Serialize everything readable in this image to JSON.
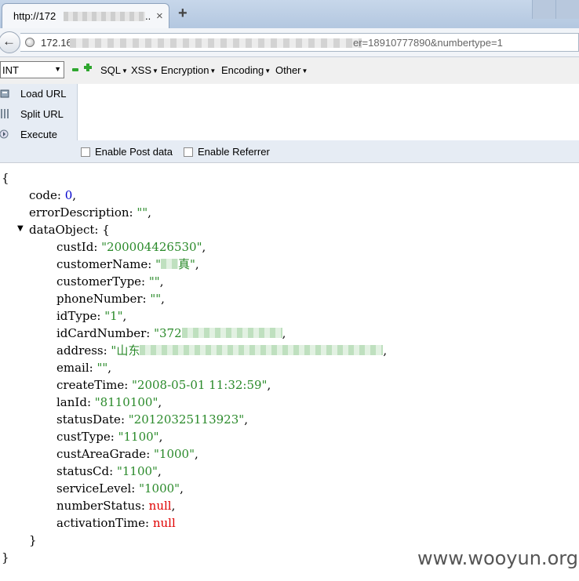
{
  "browser": {
    "tab_title": "http://172",
    "tab_ellipsis": "..",
    "close_glyph": "×",
    "newtab_glyph": "+",
    "url_prefix": "172.16",
    "url_suffix": "er=18910777890&numbertype=1"
  },
  "hackbar": {
    "type_select": "INT",
    "menus": [
      "SQL",
      "XSS",
      "Encryption",
      "Encoding",
      "Other"
    ],
    "load_url": "Load URL",
    "split_url": "Split URL",
    "execute": "Execute",
    "enable_post": "Enable Post data",
    "enable_referrer": "Enable Referrer"
  },
  "json": {
    "open_brace": "{",
    "close_brace": "}",
    "inner_open": "{",
    "inner_close": "}",
    "code": {
      "key": "code",
      "value": "0"
    },
    "errorDescription": {
      "key": "errorDescription",
      "value": "\"\""
    },
    "dataObject": {
      "key": "dataObject"
    },
    "fields": [
      {
        "key": "custId",
        "value": "\"200004426530\"",
        "type": "s"
      },
      {
        "key": "customerName",
        "value": "真\"",
        "prefix": "\"",
        "masked": true,
        "type": "s"
      },
      {
        "key": "customerType",
        "value": "\"\"",
        "type": "s"
      },
      {
        "key": "phoneNumber",
        "value": "\"\"",
        "type": "s"
      },
      {
        "key": "idType",
        "value": "\"1\"",
        "type": "s"
      },
      {
        "key": "idCardNumber",
        "value": "\"372",
        "masked": true,
        "type": "s"
      },
      {
        "key": "address",
        "value": "\"山东",
        "masked": true,
        "type": "s"
      },
      {
        "key": "email",
        "value": "\"\"",
        "type": "s"
      },
      {
        "key": "createTime",
        "value": "\"2008-05-01 11:32:59\"",
        "type": "s"
      },
      {
        "key": "lanId",
        "value": "\"8110100\"",
        "type": "s"
      },
      {
        "key": "statusDate",
        "value": "\"20120325113923\"",
        "type": "s"
      },
      {
        "key": "custType",
        "value": "\"1100\"",
        "type": "s"
      },
      {
        "key": "custAreaGrade",
        "value": "\"1000\"",
        "type": "s"
      },
      {
        "key": "statusCd",
        "value": "\"1100\"",
        "type": "s"
      },
      {
        "key": "serviceLevel",
        "value": "\"1000\"",
        "type": "s"
      },
      {
        "key": "numberStatus",
        "value": "null",
        "type": "nl"
      },
      {
        "key": "activationTime",
        "value": "null",
        "type": "nl"
      }
    ]
  },
  "watermark": "www.wooyun.org"
}
